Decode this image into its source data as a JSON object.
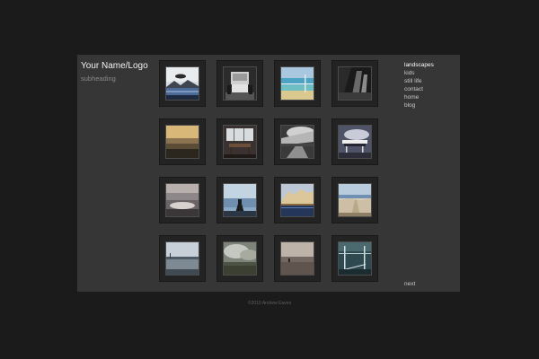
{
  "site": {
    "logo": "Your Name/Logo",
    "subheading": "subheading"
  },
  "nav": {
    "items": [
      "landscapes",
      "kids",
      "still life",
      "contact",
      "home",
      "blog"
    ],
    "active": "landscapes",
    "next": "next"
  },
  "gallery": {
    "thumbnails": [
      "mountain-lake-photo",
      "train-interior-photo",
      "beach-railing-photo",
      "dark-building-photo",
      "foggy-field-photo",
      "room-chairs-photo",
      "stormy-road-photo",
      "sky-structure-photo",
      "dusk-shore-photo",
      "jetty-silhouette-photo",
      "cliff-water-photo",
      "dune-path-photo",
      "harbour-photo",
      "cloudy-field-photo",
      "figure-beach-photo",
      "pool-lines-photo"
    ]
  },
  "footer": {
    "copyright": "©2010 Andrew Eaves"
  },
  "colors": {
    "background": "#1b1b1b",
    "panel": "#363636",
    "frame": "#232323",
    "text": "#c9c9c9"
  }
}
